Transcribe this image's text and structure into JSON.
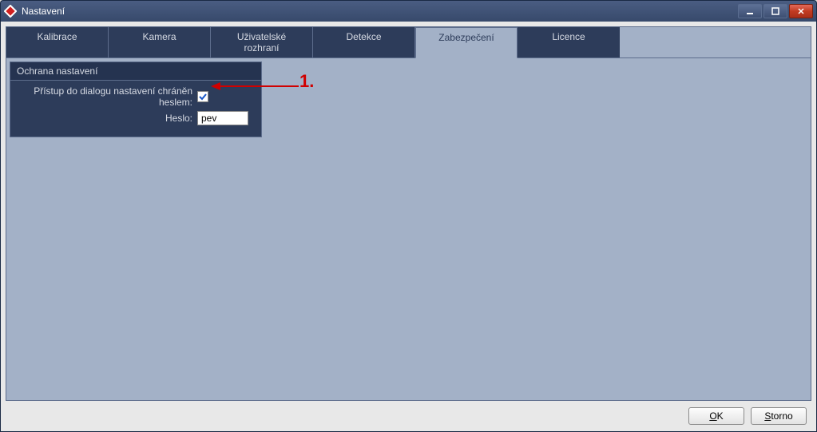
{
  "window": {
    "title": "Nastavení",
    "controls": {
      "minimize": "minimize",
      "maximize": "maximize",
      "close": "close"
    }
  },
  "tabs": [
    {
      "label": "Kalibrace",
      "active": false
    },
    {
      "label": "Kamera",
      "active": false
    },
    {
      "label": "Uživatelské rozhraní",
      "active": false
    },
    {
      "label": "Detekce",
      "active": false
    },
    {
      "label": "Zabezpečení",
      "active": true
    },
    {
      "label": "Licence",
      "active": false
    }
  ],
  "security": {
    "group_title": "Ochrana nastavení",
    "protect_label": "Přístup do dialogu nastavení chráněn heslem:",
    "protect_checked": true,
    "password_label": "Heslo:",
    "password_value": "pev"
  },
  "annotation": {
    "label": "1."
  },
  "footer": {
    "ok_label": "OK",
    "ok_underline": "O",
    "ok_rest": "K",
    "cancel_label": "Storno",
    "cancel_underline": "S",
    "cancel_rest": "torno"
  }
}
